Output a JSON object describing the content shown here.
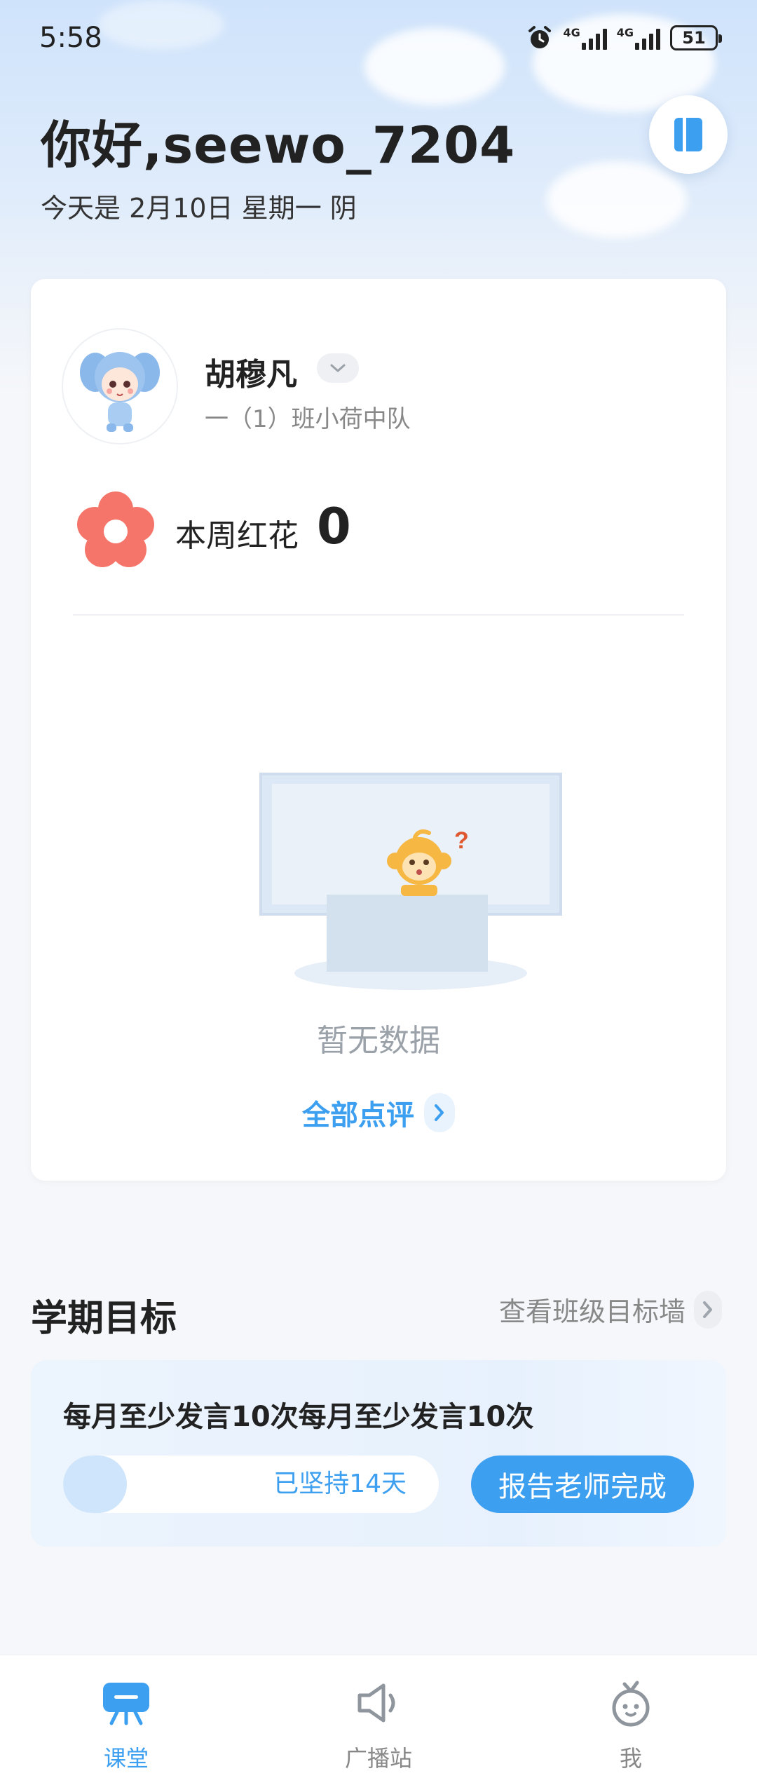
{
  "status_bar": {
    "time": "5:58",
    "network_1": "4G",
    "network_2": "4G",
    "battery": "51"
  },
  "header": {
    "greeting": "你好,seewo_7204",
    "date_line": "今天是 2月10日 星期一 阴",
    "side_button_icon": "layout-toggle-icon"
  },
  "student_card": {
    "name": "胡穆凡",
    "class": "一（1）班小荷中队",
    "weekly_flowers_label": "本周红花",
    "weekly_flowers_count": "0",
    "empty_text": "暂无数据",
    "all_reviews_label": "全部点评"
  },
  "goals": {
    "section_title": "学期目标",
    "wall_link": "查看班级目标墙",
    "items": [
      {
        "title": "每月至少发言10次每月至少发言10次",
        "progress_text": "已坚持14天",
        "progress_fraction": 0.17,
        "action_label": "报告老师完成"
      }
    ]
  },
  "tab_bar": {
    "tabs": [
      {
        "label": "课堂",
        "icon": "classroom-icon",
        "active": true
      },
      {
        "label": "广播站",
        "icon": "speaker-icon",
        "active": false
      },
      {
        "label": "我",
        "icon": "profile-icon",
        "active": false
      }
    ]
  },
  "colors": {
    "accent": "#3d9ff0",
    "flower": "#f6756a"
  }
}
